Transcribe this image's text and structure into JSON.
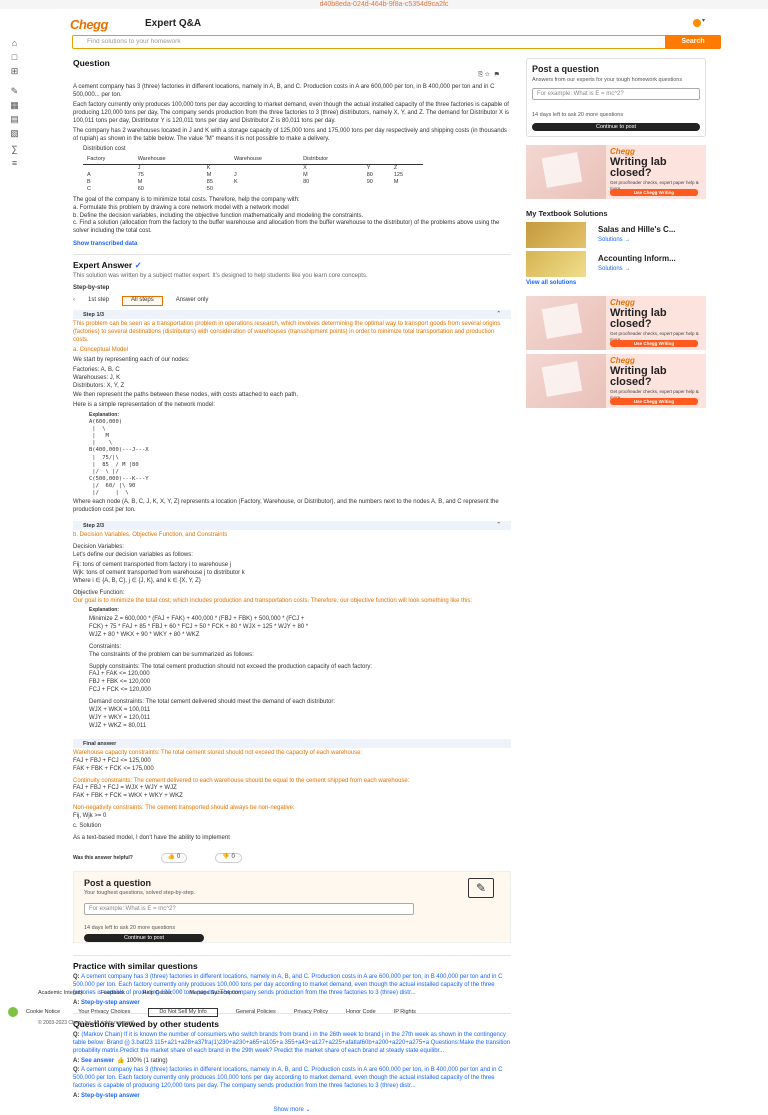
{
  "banner_id": "d40b8eda-024d-464b-9f8a-c5354d9ca2fc",
  "header": {
    "logo": "Chegg",
    "title": "Expert Q&A",
    "search_placeholder": "Find solutions to your homework",
    "search_button": "Search"
  },
  "question": {
    "heading": "Question",
    "para1": "A cement company has 3 (three) factories in different locations, namely in A, B, and C. Production costs in A are 600,000 per ton, in B 400,000 per ton and in C 500,000... per ton.",
    "para2": "Each factory currently only produces 100,000 tons per day according to market demand, even though the actual installed capacity of the three factories is capable of producing 120,000 tons per day. The company sends production from the three factories to 3 (three) distributors, namely X, Y, and Z. The demand for Distributor X is 100,011 tons per day, Distributor Y is 120,011 tons per day and Distributor Z is 80,011 tons per day.",
    "para3": "The company has 2 warehouses located in J and K with a storage capacity of 125,000 tons and 175,000 tons per day respectively and shipping costs (in thousands of rupiah) as shown in the table below. The value \"M\" means it is not possible to make a delivery.",
    "table_caption": "Distribution cost",
    "table_headers": [
      "Factory",
      "Warehouse",
      "",
      "Warehouse",
      "Distributor",
      "",
      ""
    ],
    "table_subheaders": [
      "",
      "J",
      "K",
      "",
      "X",
      "Y",
      "Z"
    ],
    "table_rows": [
      [
        "A",
        "75",
        "M",
        "J",
        "M",
        "80",
        "125"
      ],
      [
        "B",
        "M",
        "85",
        "K",
        "80",
        "90",
        "M"
      ],
      [
        "C",
        "60",
        "50",
        "",
        "",
        "",
        ""
      ]
    ],
    "para4": "The goal of the company is to minimize total costs. Therefore, help the company with:",
    "items": [
      "a.  Formulate this problem by drawing a core network model with a network model",
      "b.  Define the decision variables, including the objective function mathematically and modeling the constraints.",
      "c.  Find a solution (allocation from the factory to the buffer warehouse and allocation from the buffer warehouse to the distributor) of the problems above using the solver including the total cost."
    ],
    "show_transcribed": "Show transcribed data",
    "actions": [
      "⎘ ☆",
      "⚑"
    ]
  },
  "answer": {
    "heading": "Expert Answer",
    "verified": "✓",
    "note": "This solution was written by a subject matter expert. It's designed to help students like you learn core concepts.",
    "step_by_step": "Step-by-step",
    "tabs": [
      "1st step",
      "All steps",
      "Answer only"
    ],
    "step1_label": "Step 1/3",
    "step1_intro": "This problem can be seen as a transportation problem in operations research, which involves determining the optimal way to transport goods from several origins (factories) to several destinations (distributors) with consideration of warehouses (transshipment points) in order to minimize total transportation and production costs.",
    "step1_title": "a. Conceptual Model",
    "step1_a": "We start by representing each of our nodes:",
    "step1_nodes": "Factories: A, B, C\nWarehouses: J, K\nDistributors: X, Y, Z",
    "step1_b": "We then represent the paths between these nodes, with costs attached to each path.",
    "step1_c": "Here is a simple representation of the network model:",
    "explanation_label": "Explanation:",
    "step1_diagram": "A(600,000)\n |  \\\n |   M\n |    \\\nB(400,000)---J---X\n |  75/|\\\n |  85  / M |80\n |/  \\ |/\nC(500,000)---K---Y\n |/  60/ |\\ 90\n |/     |  \\",
    "step1_d": "Where each node (A, B, C, J, K, X, Y, Z) represents a location (Factory, Warehouse, or Distributor), and the numbers next to the nodes A, B, and C represent the production cost per ton.",
    "step2_label": "Step 2/3",
    "step2_title": "b. Decision Variables, Objective Function, and Constraints",
    "step2_dv_title": "Decision Variables:",
    "step2_dv_a": "Let's define our decision variables as follows:",
    "step2_dv_b": "Fij: tons of cement transported from factory i to warehouse j\nWjk: tons of cement transported from warehouse j to distributor k\nWhere i ∈ {A, B, C}, j ∈ {J, K}, and k ∈ {X, Y, Z}",
    "step2_of_title": "Objective Function:",
    "step2_of_a": "Our goal is to minimize the total cost, which includes production and transportation costs. Therefore, our objective function will look something like this:",
    "step2_of_expr": "Minimize Z = 600,000 * (FAJ + FAK) + 400,000 * (FBJ + FBK) + 500,000 * (FCJ +\nFCK) + 75 * FAJ + 85 * FBJ + 60 * FCJ + 50 * FCK + 80 * WJX + 125 * WJY + 80 *\nWJZ + 80 * WKX + 90 * WKY + 80 * WKZ",
    "step2_con_title": "Constraints:",
    "step2_con_a": "The constraints of the problem can be summarized as follows:",
    "step2_supply": "Supply constraints: The total cement production should not exceed the production capacity of each factory:",
    "step2_supply_eq": "FAJ + FAK <= 120,000\nFBJ + FBK <= 120,000\nFCJ + FCK <= 120,000",
    "step2_demand": "Demand constraints: The total cement delivered should meet the demand of each distributor:",
    "step2_demand_eq": "WJX + WKX = 100,011\nWJY + WKY = 120,011\nWJZ + WKZ = 80,011",
    "final_label": "Final answer",
    "final_wh": "Warehouse capacity constraints: The total cement stored should not exceed the capacity of each warehouse:",
    "final_wh_eq": "FAJ + FBJ + FCJ <= 125,000\nFAK + FBK + FCK <= 175,000",
    "final_cont": "Continuity constraints: The cement delivered to each warehouse should be equal to the cement shipped from each warehouse:",
    "final_cont_eq": "FAJ + FBJ + FCJ = WJX + WJY + WJZ\nFAK + FBK + FCK = WKX + WKY + WKZ",
    "final_nn": "Non-negativity constraints: The cement transported should always be non-negative:",
    "final_nn_eq": "Fij, Wjk >= 0",
    "final_c": "c. Solution",
    "final_c_text": "As a text-based model, I don't have the ability to implement",
    "helpful": "Was this answer helpful?",
    "up_count": "0",
    "down_count": "0"
  },
  "post_question": {
    "title": "Post a question",
    "subtitle": "Answers from our experts for your tough homework questions",
    "subtitle2": "Your toughest questions, solved step-by-step.",
    "placeholder": "For example: What is E = mc^2?",
    "quota": "14 days left to ask 20 more questions",
    "button": "Continue to post"
  },
  "ads": {
    "brand": "Chegg",
    "line1": "Writing lab",
    "line2": "closed?",
    "sub": "Get proofreader checks, expert paper help & more",
    "cta": "Use Chegg Writing"
  },
  "textbooks": {
    "heading": "My Textbook Solutions",
    "items": [
      {
        "name": "Salas and Hille's C...",
        "link": "Solutions →"
      },
      {
        "name": "Accounting Inform...",
        "link": "Solutions →"
      }
    ],
    "view_all": "View all solutions"
  },
  "practice": {
    "heading": "Practice with similar questions",
    "q_label": "Q:",
    "q": "A cement company has 3 (three) factories in different locations, namely in A, B, and C. Production costs in A are 600,000 per ton, in B 400,000 per ton and in C 500,000 per ton. Each factory currently only produces 100,000 tons per day according to market demand, even though the actual installed capacity of the three factories is capable of producing 120,000 tons per day. The company sends production from the three factories to 3 (three) distr...",
    "a_label": "A:",
    "a": "Step-by-step answer"
  },
  "viewed": {
    "heading": "Questions viewed by other students",
    "q1": "(Markov Chain) If it is known the number of consumers who switch brands from brand i in the 26th week to brand j in the 27th week as shown in the contingency table below: Brand (j) 3.batl23 115+a21+a28+a37fra(1)230+a230+a65+a105+a 355+a43+a127+a225+afatlat60b+a200+a220+a275+a Questions:Make the transition probability matrix.Predict the market share of each brand in the 29th week? Predict the market share of each brand at steady state equilibr...",
    "a1_label": "A:",
    "a1": "See answer",
    "a1_rating": "100% (1 rating)",
    "q2": "A cement company has 3 (three) factories in different locations, namely in A, B, and C. Production costs in A are 600,000 per ton, in B 400,000 per ton and in C 500,000 per ton. Each factory currently only produces 100,000 tons per day according to market demand, even though the actual installed capacity of the three factories is capable of producing 120,000 tons per day. The company sends production from the three factories to 3 (three) distr...",
    "a2_label": "A:",
    "a2": "Step-by-step answer",
    "show_more": "Show more"
  },
  "footer": {
    "links1": [
      "Academic Integrity",
      "Feedback",
      "Help Center",
      "Manage Subscription"
    ],
    "links2": [
      "Cookie Notice",
      "Your Privacy Choices",
      "Do Not Sell My Info",
      "General Policies",
      "Privacy Policy",
      "Honor Code",
      "IP Rights"
    ],
    "copyright": "© 2003-2023 Chegg Inc. All rights reserved."
  }
}
